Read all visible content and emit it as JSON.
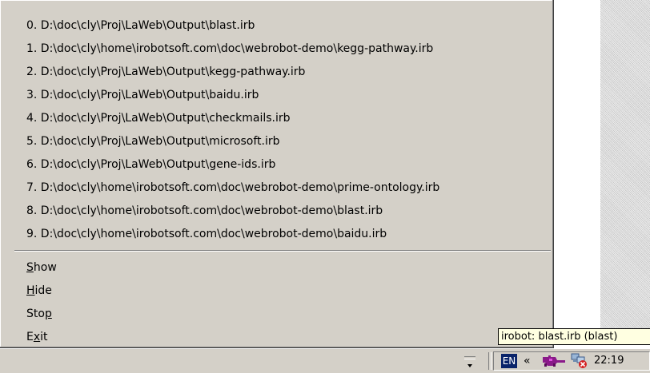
{
  "menu": {
    "recent_files": [
      "0. D:\\doc\\cly\\Proj\\LaWeb\\Output\\blast.irb",
      "1. D:\\doc\\cly\\home\\irobotsoft.com\\doc\\webrobot-demo\\kegg-pathway.irb",
      "2. D:\\doc\\cly\\Proj\\LaWeb\\Output\\kegg-pathway.irb",
      "3. D:\\doc\\cly\\Proj\\LaWeb\\Output\\baidu.irb",
      "4. D:\\doc\\cly\\Proj\\LaWeb\\Output\\checkmails.irb",
      "5. D:\\doc\\cly\\Proj\\LaWeb\\Output\\microsoft.irb",
      "6. D:\\doc\\cly\\Proj\\LaWeb\\Output\\gene-ids.irb",
      "7. D:\\doc\\cly\\home\\irobotsoft.com\\doc\\webrobot-demo\\prime-ontology.irb",
      "8. D:\\doc\\cly\\home\\irobotsoft.com\\doc\\webrobot-demo\\blast.irb",
      "9. D:\\doc\\cly\\home\\irobotsoft.com\\doc\\webrobot-demo\\baidu.irb"
    ],
    "commands": {
      "show": {
        "accel": "S",
        "rest": "how"
      },
      "hide": {
        "accel": "H",
        "rest": "ide"
      },
      "stop": {
        "pre": "Sto",
        "accel": "p"
      },
      "exit": {
        "pre": "E",
        "accel": "x",
        "post": "it"
      }
    }
  },
  "tooltip": "irobot: blast.irb (blast)",
  "taskbar": {
    "language": "EN",
    "chevron": "«",
    "clock": "22:19",
    "icons": [
      "grip-arrow-icon",
      "robot-icon",
      "network-error-icon"
    ]
  },
  "colors": {
    "menu_bg": "#d4d0c8",
    "tooltip_bg": "#ffffe1",
    "lang_bg": "#0a246a"
  }
}
